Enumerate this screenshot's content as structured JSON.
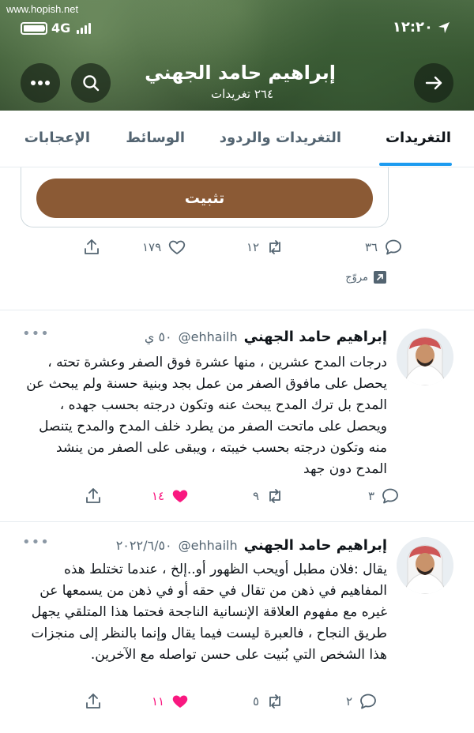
{
  "watermark": "www.hopish.net",
  "status": {
    "time": "١٢:٢٠",
    "network": "4G"
  },
  "profile": {
    "name": "إبراهيم حامد الجهني",
    "tweet_count": "٢٦٤ تغريدات"
  },
  "tabs": [
    {
      "label": "التغريدات",
      "active": true
    },
    {
      "label": "التغريدات والردود",
      "active": false
    },
    {
      "label": "الوسائط",
      "active": false
    },
    {
      "label": "الإعجابات",
      "active": false
    }
  ],
  "pinned_card": {
    "button_label": "تثبيت",
    "actions": {
      "replies": "٣٦",
      "retweets": "١٢",
      "likes": "١٧٩"
    },
    "promoted_label": "مروّج"
  },
  "tweets": [
    {
      "name": "إبراهيم حامد الجهني",
      "handle": "@ehhailh",
      "time": "٥٠ ي",
      "text": "درجات المدح عشرين ، منها عشرة فوق الصفر وعشرة تحته ، يحصل على  مافوق الصفر من عمل بجد وبنية حسنة ولم يبحث عن المدح بل ترك المدح يبحث عنه وتكون درجته بحسب جهده ، ويحصل على ماتحت الصفر من يطرد خلف المدح والمدح يتنصل منه وتكون درجته بحسب خيبته ، ويبقى على الصفر من ينشد المدح دون جهد",
      "replies": "٣",
      "retweets": "٩",
      "likes": "١٤",
      "liked": true
    },
    {
      "name": "إبراهيم حامد الجهني",
      "handle": "@ehhailh",
      "time": "٢٠٢٢/٦/٥٠",
      "text": "يقال :فلان مطبل أويحب الظهور أو..إلخ ، عندما تختلط هذه المفاهيم في ذهن من تقال في حقه أو في ذهن من يسمعها عن غيره مع مفهوم العلاقة الإنسانية الناجحة فحتما هذا المتلقي يجهل طريق النجاح ، فالعبرة ليست فيما يقال وإنما بالنظر إلى منجزات هذا الشخص التي بُنيت على حسن تواصله مع الآخرين.",
      "replies": "٢",
      "retweets": "٥",
      "likes": "١١",
      "liked": true
    }
  ],
  "colors": {
    "accent": "#1d9bf0",
    "pin_button": "#8b5a35",
    "like": "#f91880"
  },
  "icons": [
    "back-arrow-icon",
    "search-icon",
    "more-icon",
    "reply-icon",
    "retweet-icon",
    "heart-icon",
    "share-icon",
    "promoted-icon"
  ]
}
